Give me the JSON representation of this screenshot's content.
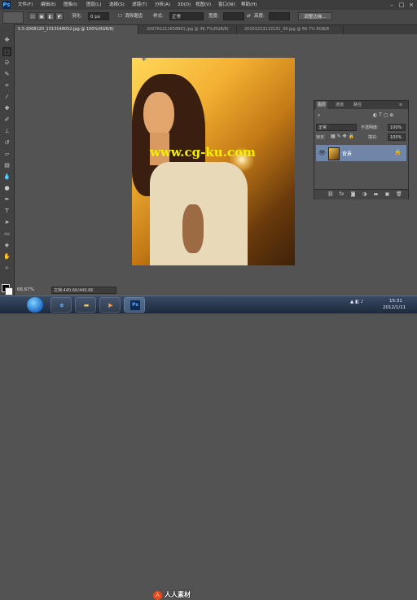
{
  "app": {
    "logo": "Ps"
  },
  "menubar": {
    "items": [
      "文件(F)",
      "编辑(E)",
      "图像(I)",
      "图层(L)",
      "选择(S)",
      "滤镜(T)",
      "分析(A)",
      "3D(D)",
      "视图(V)",
      "窗口(W)",
      "帮助(H)"
    ]
  },
  "window_controls": {
    "minimize": "–",
    "maximize": "□",
    "close": "×"
  },
  "options_bar": {
    "feather_label": "羽化:",
    "feather_value": "0 px",
    "antialias_label": "消除锯齿",
    "style_label": "样式:",
    "style_value": "正常",
    "width_label": "宽度:",
    "height_label": "高度:",
    "refine_edge": "调整边缘..."
  },
  "doc_tabs": [
    {
      "label": "5.5-2008120_1313148052.jpg @ 100%(RGB/8)",
      "active": true
    },
    {
      "label": "200762211658901.jpg @ 36.7%(RGB/8)",
      "active": false
    },
    {
      "label": "20101213113131_35.jpg @ 66.7% RGB/8",
      "active": false
    }
  ],
  "canvas": {
    "watermark": "www.cg-ku.com",
    "cursor": "+"
  },
  "layers_panel": {
    "tabs": [
      "图层",
      "通道",
      "路径"
    ],
    "blend_mode": "正常",
    "opacity_label": "不透明度:",
    "opacity_value": "100%",
    "lock_label": "锁定:",
    "fill_label": "填充:",
    "fill_value": "100%",
    "layers": [
      {
        "name": "背景",
        "visible": true,
        "locked": true
      }
    ]
  },
  "status_bar": {
    "zoom": "66.67%",
    "doc_info": "文档:440.6K/440.6K"
  },
  "taskbar": {
    "apps": [
      "Internet Explorer",
      "文件夹",
      "Media Player",
      "Photoshop"
    ],
    "active_app": "Photoshop",
    "brand_text": "人人素材",
    "time": "15:31",
    "date": "2012/1/11"
  },
  "colors": {
    "accent_selected_layer": "#6f86a8",
    "watermark": "#f5f000",
    "workspace": "#535353"
  }
}
